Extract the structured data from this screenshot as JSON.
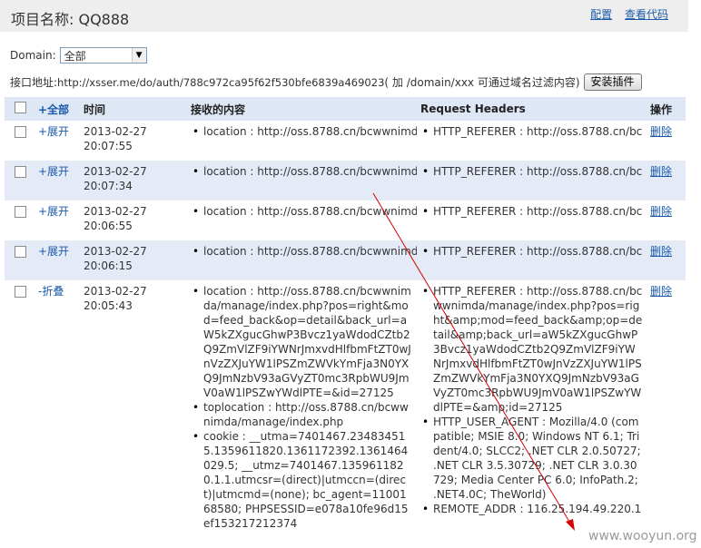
{
  "header": {
    "title": "项目名称: QQ888",
    "config_link": "配置",
    "code_link": "查看代码"
  },
  "domain": {
    "label": "Domain:",
    "selected": "全部"
  },
  "api": {
    "label": "接口地址: ",
    "url": "http://xsser.me/do/auth/788c972ca95f62f530bfe6839a469023",
    "note": " ( 加 /domain/xxx 可通过域名过滤内容)",
    "install_button": "安装插件"
  },
  "table": {
    "headers": {
      "all": "+全部",
      "time": "时间",
      "content": "接收的内容",
      "request_headers": "Request Headers",
      "actions": "操作"
    },
    "rows": [
      {
        "expand": "+展开",
        "date": "2013-02-27",
        "clock": "20:07:55",
        "content": "location : http://oss.8788.cn/bcwwnimda",
        "headers": "HTTP_REFERER : http://oss.8788.cn/bc",
        "delete": "删除"
      },
      {
        "expand": "+展开",
        "date": "2013-02-27",
        "clock": "20:07:34",
        "content": "location : http://oss.8788.cn/bcwwnimda",
        "headers": "HTTP_REFERER : http://oss.8788.cn/bc",
        "delete": "删除"
      },
      {
        "expand": "+展开",
        "date": "2013-02-27",
        "clock": "20:06:55",
        "content": "location : http://oss.8788.cn/bcwwnimda",
        "headers": "HTTP_REFERER : http://oss.8788.cn/bc",
        "delete": "删除"
      },
      {
        "expand": "+展开",
        "date": "2013-02-27",
        "clock": "20:06:15",
        "content": "location : http://oss.8788.cn/bcwwnimda",
        "headers": "HTTP_REFERER : http://oss.8788.cn/bc",
        "delete": "删除"
      },
      {
        "expand": "-折叠",
        "date": "2013-02-27",
        "clock": "20:05:43",
        "content_items": [
          "location : http://oss.8788.cn/bcwwnimda/manage/index.php?pos=right&mod=feed_back&op=detail&back_url=aW5kZXgucGhwP3Bvcz1yaWdodCZtb2Q9ZmVlZF9iYWNrJmxvdHlfbmFtZT0wJnVzZXJuYW1lPSZmZWVkYmFja3N0YXQ9JmNzbV93aGVyZT0mc3RpbWU9JmV0aW1lPSZwYWdlPTE=&id=27125",
          "toplocation : http://oss.8788.cn/bcwwnimda/manage/index.php",
          "cookie : __utma=7401467.234834515.1359611820.1361172392.1361464029.5; __utmz=7401467.1359611820.1.1.utmcsr=(direct)|utmccn=(direct)|utmcmd=(none); bc_agent=1100168580; PHPSESSID=e078a10fe96d15ef153217212374"
        ],
        "header_items": [
          "HTTP_REFERER : http://oss.8788.cn/bcwwnimda/manage/index.php?pos=right&amp;mod=feed_back&amp;op=detail&amp;back_url=aW5kZXgucGhwP3Bvcz1yaWdodCZtb2Q9ZmVlZF9iYWNrJmxvdHlfbmFtZT0wJnVzZXJuYW1lPSZmZWVkYmFja3N0YXQ9JmNzbV93aGVyZT0mc3RpbWU9JmV0aW1lPSZwYWdlPTE=&amp;id=27125",
          "HTTP_USER_AGENT : Mozilla/4.0 (compatible; MSIE 8.0; Windows NT 6.1; Trident/4.0; SLCC2; .NET CLR 2.0.50727; .NET CLR 3.5.30729; .NET CLR 3.0.30729; Media Center PC 6.0; InfoPath.2; .NET4.0C; TheWorld)",
          "REMOTE_ADDR : 116.25.194.49.220.1"
        ],
        "delete": "删除"
      }
    ]
  },
  "watermark": "www.wooyun.org",
  "colors": {
    "link": "#1a5aa8",
    "row_alt": "#e4ebf7",
    "header_bg": "#dde7f5",
    "annotation_arrow": "#d40000"
  }
}
